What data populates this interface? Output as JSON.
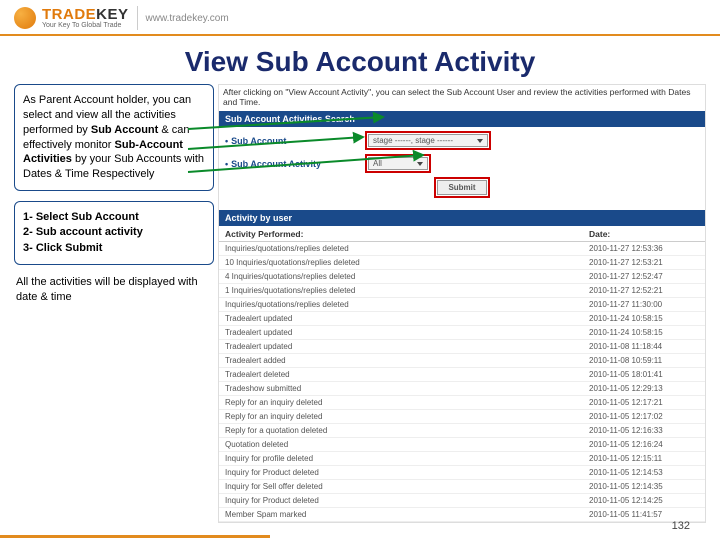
{
  "header": {
    "brand_prefix": "TRADE",
    "brand_suffix": "KEY",
    "tagline": "Your Key To Global Trade",
    "url": "www.tradekey.com"
  },
  "slide": {
    "title": "View Sub Account Activity",
    "page_number": "132"
  },
  "left": {
    "info_part1": "As Parent Account holder, you can select and view all the activities performed by ",
    "info_bold1": "Sub Account",
    "info_part2": " & can effectively monitor ",
    "info_bold2": "Sub-Account Activities",
    "info_part3": " by your Sub Accounts with Dates & Time Respectively",
    "step1": "1- Select Sub Account",
    "step2": "2- Sub account activity",
    "step3": "3- Click Submit",
    "below": "All the activities will be displayed with date & time"
  },
  "screenshot": {
    "caption": "After clicking on \"View Account Activity\", you can select the Sub Account User and review the activities performed with Dates and Time.",
    "search_title": "Sub Account Activities Search",
    "row1_label": "Sub Account",
    "row1_value": "stage ------, stage ------",
    "row2_label": "Sub Account Activity",
    "row2_value": "All",
    "submit": "Submit",
    "activity_title": "Activity by user",
    "col_activity": "Activity Performed:",
    "col_date": "Date:",
    "rows": [
      {
        "a": "Inquiries/quotations/replies deleted",
        "d": "2010-11-27 12:53:36"
      },
      {
        "a": "10 Inquiries/quotations/replies deleted",
        "d": "2010-11-27 12:53:21"
      },
      {
        "a": "4 Inquiries/quotations/replies deleted",
        "d": "2010-11-27 12:52:47"
      },
      {
        "a": "1 Inquiries/quotations/replies deleted",
        "d": "2010-11-27 12:52:21"
      },
      {
        "a": "Inquiries/quotations/replies deleted",
        "d": "2010-11-27 11:30:00"
      },
      {
        "a": "Tradealert updated",
        "d": "2010-11-24 10:58:15"
      },
      {
        "a": "Tradealert updated",
        "d": "2010-11-24 10:58:15"
      },
      {
        "a": "Tradealert updated",
        "d": "2010-11-08 11:18:44"
      },
      {
        "a": "Tradealert added",
        "d": "2010-11-08 10:59:11"
      },
      {
        "a": "Tradealert deleted",
        "d": "2010-11-05 18:01:41"
      },
      {
        "a": "Tradeshow submitted",
        "d": "2010-11-05 12:29:13"
      },
      {
        "a": "Reply for an inquiry deleted",
        "d": "2010-11-05 12:17:21"
      },
      {
        "a": "Reply for an inquiry deleted",
        "d": "2010-11-05 12:17:02"
      },
      {
        "a": "Reply for a quotation deleted",
        "d": "2010-11-05 12:16:33"
      },
      {
        "a": "Quotation deleted",
        "d": "2010-11-05 12:16:24"
      },
      {
        "a": "Inquiry for profile deleted",
        "d": "2010-11-05 12:15:11"
      },
      {
        "a": "Inquiry for Product deleted",
        "d": "2010-11-05 12:14:53"
      },
      {
        "a": "Inquiry for Sell offer deleted",
        "d": "2010-11-05 12:14:35"
      },
      {
        "a": "Inquiry for Product deleted",
        "d": "2010-11-05 12:14:25"
      },
      {
        "a": "Member Spam marked",
        "d": "2010-11-05 11:41:57"
      }
    ]
  }
}
